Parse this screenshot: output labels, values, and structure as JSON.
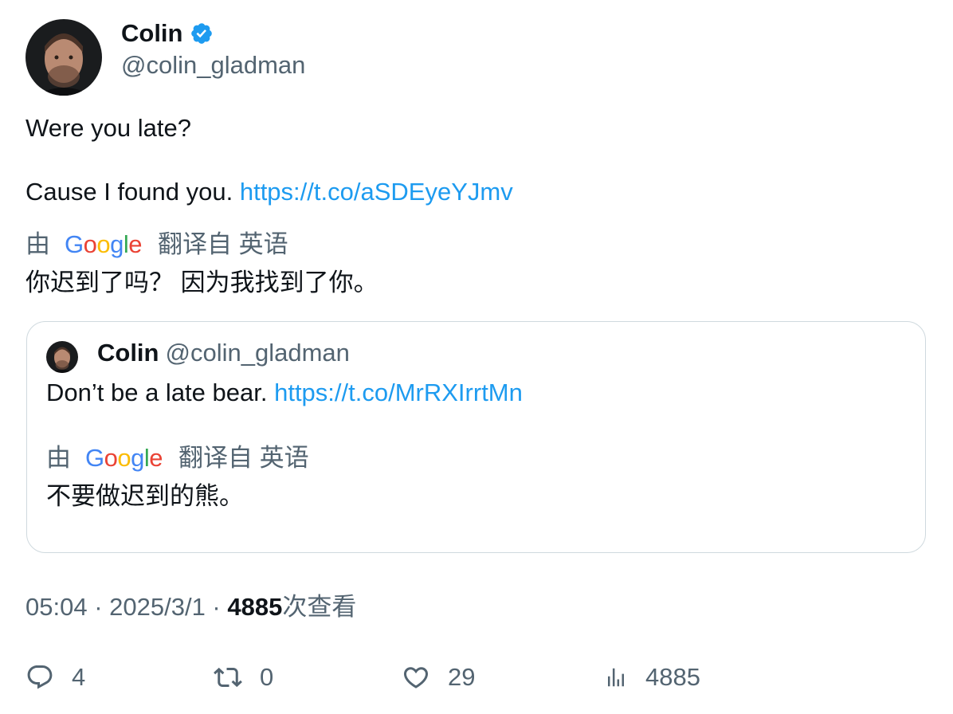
{
  "author": {
    "name": "Colin",
    "handle": "@colin_gladman",
    "verified_icon": "verified-badge-icon",
    "verified_color": "#1d9bf0"
  },
  "tweet": {
    "line1": "Were you late?",
    "line2_text": "Cause I found you. ",
    "line2_link": "https://t.co/aSDEyeYJmv",
    "translation": {
      "prefix": "由",
      "engine": [
        "G",
        "o",
        "o",
        "g",
        "l",
        "e"
      ],
      "suffix": "翻译自 英语",
      "text": "你迟到了吗？ 因为我找到了你。"
    }
  },
  "quote": {
    "name": "Colin",
    "handle": "@colin_gladman",
    "text": "Don’t be a late bear. ",
    "link": "https://t.co/MrRXIrrtMn",
    "translation": {
      "prefix": "由",
      "suffix": "翻译自 英语",
      "text": "不要做迟到的熊。"
    }
  },
  "meta": {
    "time": "05:04",
    "sep1": " · ",
    "date": "2025/3/1",
    "sep2": " · ",
    "views_count": "4885",
    "views_label": "次查看"
  },
  "actions": {
    "replies": "4",
    "retweets": "0",
    "likes": "29",
    "views": "4885"
  },
  "colors": {
    "link": "#1d9bf0",
    "secondary_text": "#536471",
    "primary_text": "#0f1419",
    "google_blue": "#4285F4",
    "google_red": "#EA4335",
    "google_yellow": "#FBBC05",
    "google_green": "#34A853"
  }
}
